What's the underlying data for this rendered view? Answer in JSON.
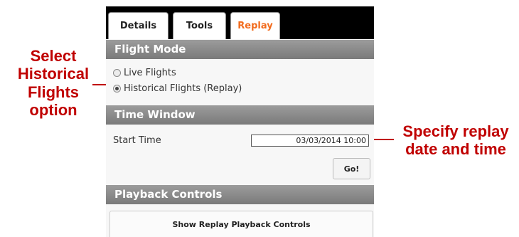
{
  "tabs": [
    {
      "label": "Details",
      "active": false
    },
    {
      "label": "Tools",
      "active": false
    },
    {
      "label": "Replay",
      "active": true
    }
  ],
  "accent_color": "#f26b1d",
  "callout_color": "#c00000",
  "flight_mode": {
    "header": "Flight Mode",
    "options": [
      {
        "label": "Live Flights",
        "selected": false
      },
      {
        "label": "Historical Flights (Replay)",
        "selected": true
      }
    ]
  },
  "time_window": {
    "header": "Time Window",
    "start_time_label": "Start Time",
    "start_time_value": "03/03/2014 10:00",
    "go_label": "Go!"
  },
  "playback": {
    "header": "Playback Controls",
    "button_label": "Show Replay Playback Controls"
  },
  "callouts": {
    "left": "Select\nHistorical\nFlights\noption",
    "right": "Specify replay\ndate and time"
  }
}
